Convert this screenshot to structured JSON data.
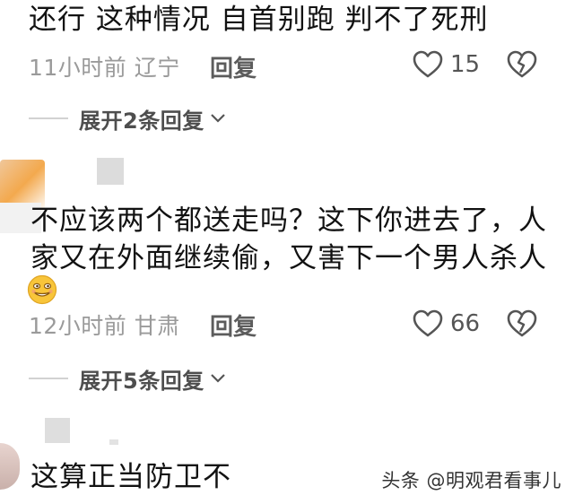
{
  "comments": [
    {
      "text": "还行 这种情况 自首别跑 判不了死刑",
      "time_location": "11小时前 辽宁",
      "reply_label": "回复",
      "likes": "15",
      "expand_label": "展开2条回复"
    },
    {
      "text_line1": "不应该两个都送走吗？这下你进去了，人",
      "text_line2": "家又在外面继续偷，又害下一个男人杀人",
      "emoji": "grinning-face-emoji",
      "time_location": "12小时前 甘肃",
      "reply_label": "回复",
      "likes": "66",
      "expand_label": "展开5条回复"
    },
    {
      "text": "这算正当防卫不"
    }
  ],
  "watermark": "头条 @明观君看事儿",
  "icons": {
    "like": "heart-outline-icon",
    "dislike": "broken-heart-icon",
    "expand": "chevron-down-icon"
  },
  "colors": {
    "text": "#121212",
    "meta": "#9a9a9a",
    "reply": "#5c5c5c"
  }
}
